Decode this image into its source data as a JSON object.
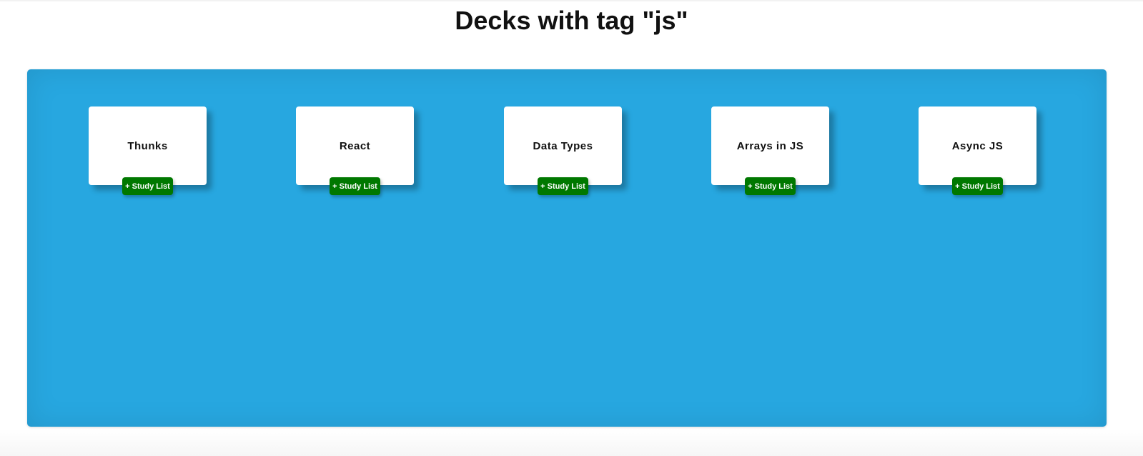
{
  "page": {
    "title": "Decks with tag \"js\""
  },
  "colors": {
    "panel_background": "#27a7e0",
    "card_background": "#ffffff",
    "study_button": "#007800",
    "title_text": "#111111"
  },
  "decks": [
    {
      "name": "Thunks",
      "button_label": "+ Study List"
    },
    {
      "name": "React",
      "button_label": "+ Study List"
    },
    {
      "name": "Data Types",
      "button_label": "+ Study List"
    },
    {
      "name": "Arrays in JS",
      "button_label": "+ Study List"
    },
    {
      "name": "Async JS",
      "button_label": "+ Study List"
    }
  ]
}
